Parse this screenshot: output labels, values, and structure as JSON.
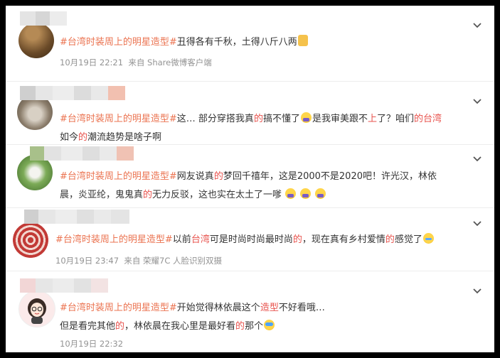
{
  "posts": [
    {
      "hashtag": "#台湾时装周上的明星造型#",
      "body_segments": [
        "丑得各有千秋，土得八斤八两"
      ],
      "emoji": [
        "thumbs-up-icon"
      ],
      "time": "10月19日 22:21",
      "source": "来自 Share微博客户端"
    },
    {
      "hashtag": "#台湾时装周上的明星造型#",
      "line1": {
        "a": "这… 部分穿搭我真",
        "b": "的",
        "c": "搞不懂了",
        "d": "是我审美跟不",
        "e": "上",
        "f": "了？咱们",
        "g": "的台湾"
      },
      "line2": {
        "a": "如今",
        "b": "的",
        "c": "潮流趋势是啥子啊"
      }
    },
    {
      "hashtag": "#台湾时装周上的明星造型#",
      "line1": {
        "a": "网友说真",
        "b": "的",
        "c": "梦回千禧年，这是2000不是2020吧！许光汉，林依"
      },
      "line2": {
        "a": "晨，炎亚纶，鬼鬼真",
        "b": "的",
        "c": "无力反驳，这也实在太土了一嗲"
      }
    },
    {
      "hashtag": "#台湾时装周上的明星造型#",
      "line1": {
        "a": "以前",
        "b": "台湾",
        "c": "可是时尚时尚最时尚",
        "d": "的",
        "e": "，现在真有乡村爱情",
        "f": "的",
        "g": "感觉了"
      },
      "time": "10月19日 23:47",
      "source": "来自 荣耀7C 人脸识别双摄"
    },
    {
      "hashtag": "#台湾时装周上的明星造型#",
      "line1": {
        "a": "开始觉得林依晨这个",
        "b": "造型",
        "c": "不好看哦…"
      },
      "line2": {
        "a": "但是看完其他",
        "b": "的",
        "c": "，林依晨在我心里是最好看",
        "d": "的",
        "e": "那个"
      },
      "time": "10月19日 22:32"
    }
  ],
  "colors": {
    "hashtag": "#eb7350",
    "highlight": "#e8534d",
    "meta": "#939393"
  }
}
